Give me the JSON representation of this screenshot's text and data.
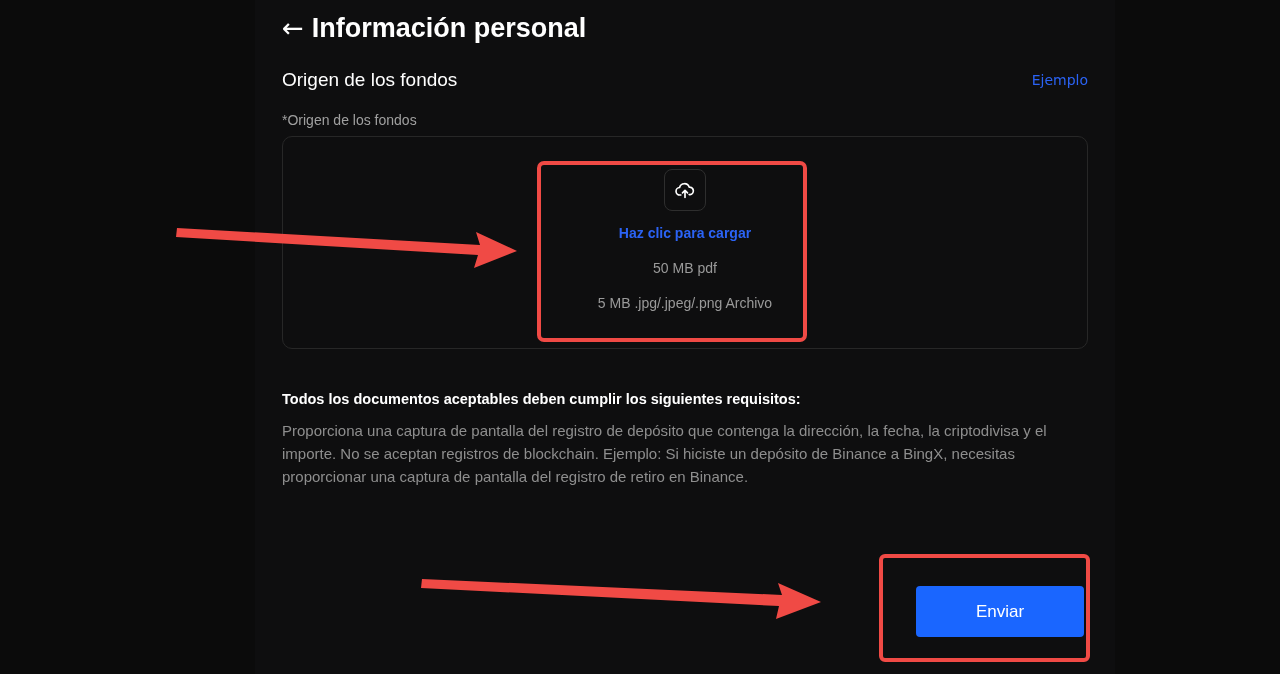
{
  "header": {
    "back_icon": "←",
    "title": "Información personal"
  },
  "section": {
    "title": "Origen de los fondos",
    "example_link": "Ejemplo"
  },
  "upload": {
    "label": "*Origen de los fondos",
    "action": "Haz clic para cargar",
    "limits": [
      "50 MB pdf",
      "5 MB .jpg/.jpeg/.png Archivo"
    ]
  },
  "requirements": {
    "title": "Todos los documentos aceptables deben cumplir los siguientes requisitos:",
    "text": "Proporciona una captura de pantalla del registro de depósito que contenga la dirección, la fecha, la criptodivisa y el importe. No se aceptan registros de blockchain. Ejemplo: Si hiciste un depósito de Binance a BingX, necesitas proporcionar una captura de pantalla del registro de retiro en Binance."
  },
  "buttons": [
    {
      "label": "Enviar",
      "kind": "primary"
    }
  ]
}
